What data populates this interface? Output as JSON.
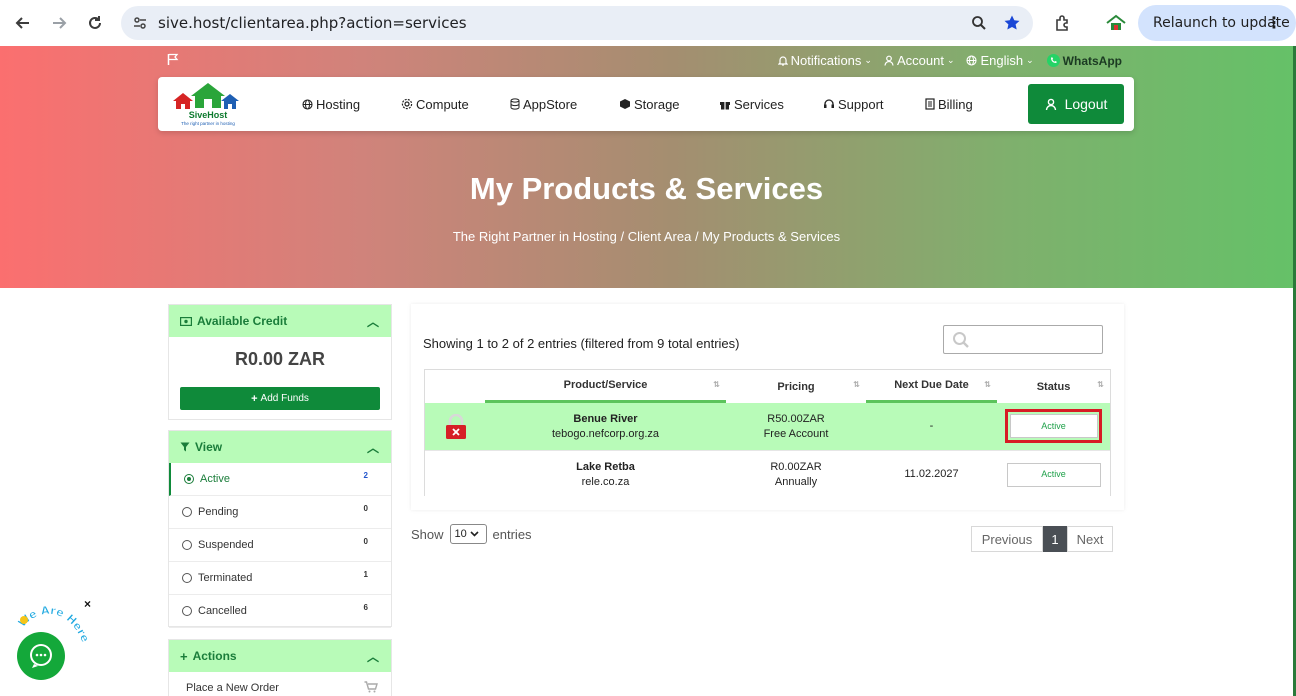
{
  "browser": {
    "url": "sive.host/clientarea.php?action=services",
    "relaunch_label": "Relaunch to update"
  },
  "topbar": {
    "notifications": "Notifications",
    "account": "Account",
    "language": "English",
    "whatsapp": "WhatsApp"
  },
  "logo": {
    "brand": "SiveHost",
    "tagline": "The right partner in hosting"
  },
  "nav": {
    "items": [
      {
        "label": "Hosting",
        "icon": "globe-icon"
      },
      {
        "label": "Compute",
        "icon": "gear-icon"
      },
      {
        "label": "AppStore",
        "icon": "database-icon"
      },
      {
        "label": "Storage",
        "icon": "box-icon"
      },
      {
        "label": "Services",
        "icon": "gift-icon"
      },
      {
        "label": "Support",
        "icon": "headset-icon"
      },
      {
        "label": "Billing",
        "icon": "invoice-icon"
      }
    ],
    "logout": "Logout"
  },
  "hero": {
    "title": "My Products & Services",
    "breadcrumb": [
      "The Right Partner in Hosting",
      "Client Area",
      "My Products & Services"
    ]
  },
  "sidebar": {
    "credit": {
      "title": "Available Credit",
      "value": "R0.00 ZAR",
      "add_funds": "Add Funds"
    },
    "view": {
      "title": "View",
      "items": [
        {
          "label": "Active",
          "count": "2",
          "selected": true
        },
        {
          "label": "Pending",
          "count": "0",
          "selected": false
        },
        {
          "label": "Suspended",
          "count": "0",
          "selected": false
        },
        {
          "label": "Terminated",
          "count": "1",
          "selected": false
        },
        {
          "label": "Cancelled",
          "count": "6",
          "selected": false
        }
      ]
    },
    "actions": {
      "title": "Actions",
      "items": [
        "Place a New Order"
      ]
    }
  },
  "main": {
    "showing": "Showing 1 to 2 of 2 entries (filtered from 9 total entries)",
    "search_placeholder": "",
    "columns": [
      "Product/Service",
      "Pricing",
      "Next Due Date",
      "Status"
    ],
    "rows": [
      {
        "name": "Benue River",
        "domain": "tebogo.nefcorp.org.za",
        "price": "R50.00ZAR",
        "cycle": "Free Account",
        "due": "-",
        "status": "Active"
      },
      {
        "name": "Lake Retba",
        "domain": "rele.co.za",
        "price": "R0.00ZAR",
        "cycle": "Annually",
        "due": "11.02.2027",
        "status": "Active"
      }
    ],
    "show_label": "Show",
    "entries_label": "entries",
    "page_size": "10",
    "pagination": {
      "previous": "Previous",
      "current": "1",
      "next": "Next"
    }
  },
  "chat": {
    "badge_text": "We Are Here!",
    "close": "×"
  },
  "colors": {
    "brand_green": "#0f8a3a",
    "light_green": "#b8fbb8",
    "highlight_red": "#d71b24"
  }
}
